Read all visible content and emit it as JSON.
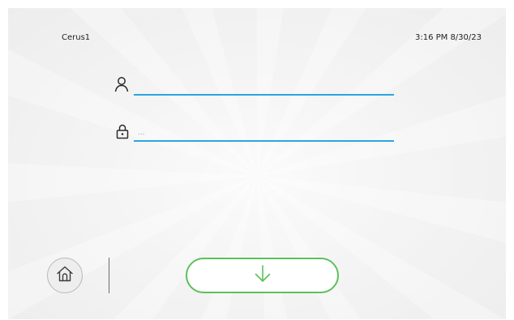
{
  "header": {
    "device_name": "Cerus1",
    "datetime": "3:16 PM 8/30/23"
  },
  "login": {
    "username": {
      "icon": "user-icon",
      "value": ""
    },
    "password": {
      "icon": "lock-icon",
      "value": "..."
    }
  },
  "footer": {
    "home_icon": "home-icon",
    "login_icon": "arrow-down-icon"
  },
  "colors": {
    "field_underline": "#2aa6de",
    "login_button_border": "#5cc05b",
    "text": "#1f1f1f"
  }
}
